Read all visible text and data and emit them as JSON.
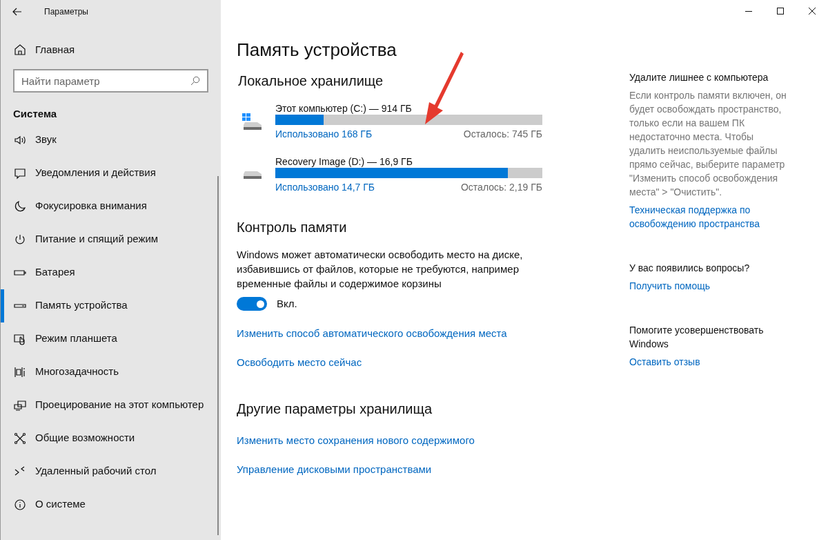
{
  "window": {
    "title": "Параметры"
  },
  "sidebar": {
    "home": "Главная",
    "search": {
      "placeholder": "Найти параметр"
    },
    "section": "Система",
    "items": [
      {
        "label": "Звук",
        "selected": false
      },
      {
        "label": "Уведомления и действия",
        "selected": false
      },
      {
        "label": "Фокусировка внимания",
        "selected": false
      },
      {
        "label": "Питание и спящий режим",
        "selected": false
      },
      {
        "label": "Батарея",
        "selected": false
      },
      {
        "label": "Память устройства",
        "selected": true
      },
      {
        "label": "Режим планшета",
        "selected": false
      },
      {
        "label": "Многозадачность",
        "selected": false
      },
      {
        "label": "Проецирование на этот компьютер",
        "selected": false
      },
      {
        "label": "Общие возможности",
        "selected": false
      },
      {
        "label": "Удаленный рабочий стол",
        "selected": false
      },
      {
        "label": "О системе",
        "selected": false
      }
    ]
  },
  "main": {
    "title": "Память устройства",
    "local_storage": {
      "heading": "Локальное хранилище",
      "drives": [
        {
          "kind": "system",
          "name": "Этот компьютер (C:) — 914 ГБ",
          "level": 0.18,
          "used": "Использовано 168 ГБ",
          "free": "Осталось: 745 ГБ"
        },
        {
          "kind": "data",
          "name": "Recovery Image (D:) — 16,9 ГБ",
          "level": 0.87,
          "used": "Использовано 14,7 ГБ",
          "free": "Осталось: 2,19 ГБ"
        }
      ]
    },
    "storage_sense": {
      "heading": "Контроль памяти",
      "description": "Windows может автоматически освободить место на диске, избавившись от файлов, которые не требуются, например временные файлы и содержимое корзины",
      "toggle": {
        "on": true,
        "label": "Вкл."
      },
      "links": [
        "Изменить способ автоматического освобождения места",
        "Освободить место сейчас"
      ]
    },
    "other": {
      "heading": "Другие параметры хранилища",
      "links": [
        "Изменить место сохранения нового содержимого",
        "Управление дисковыми пространствами"
      ]
    }
  },
  "aside": {
    "sections": [
      {
        "heading": "Удалите лишнее с компьютера",
        "text": "Если контроль памяти включен, он будет освобождать пространство, только если на вашем ПК недостаточно места. Чтобы удалить неиспользуемые файлы прямо сейчас, выберите параметр \"Изменить способ освобождения места\" > \"Очистить\".",
        "link": "Техническая поддержка по освобождению пространства"
      },
      {
        "heading": "У вас появились вопросы?",
        "link": "Получить помощь"
      },
      {
        "heading": "Помогите усовершенствовать Windows",
        "link": "Оставить отзыв"
      }
    ]
  }
}
